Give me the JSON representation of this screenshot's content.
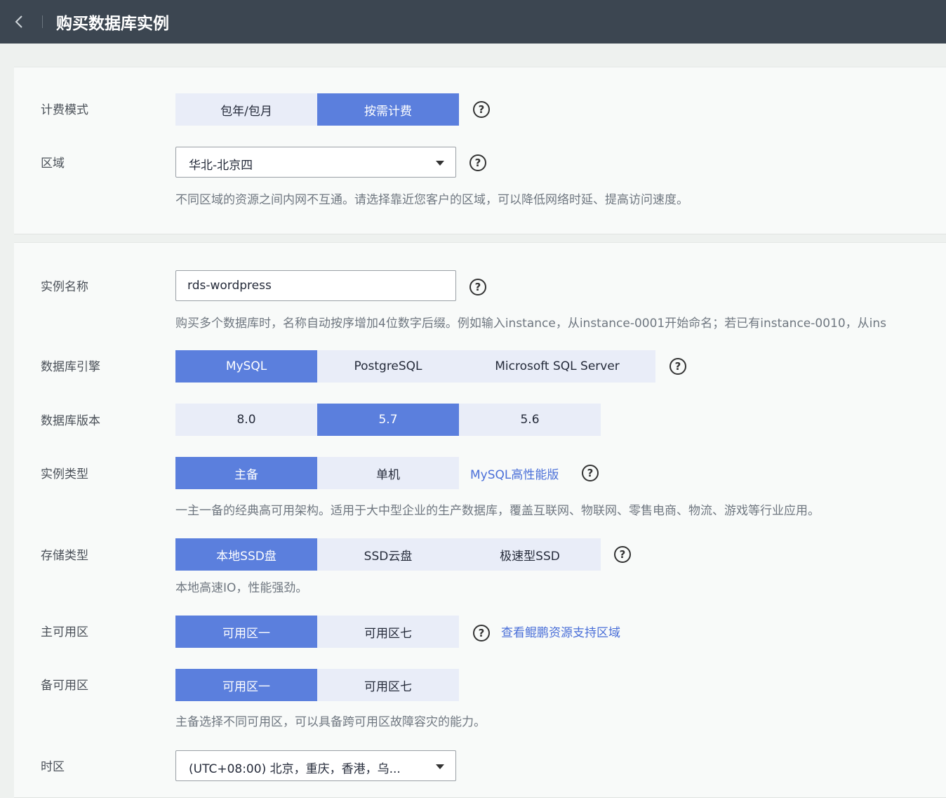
{
  "header": {
    "title": "购买数据库实例"
  },
  "billing": {
    "label": "计费模式",
    "options": [
      "包年/包月",
      "按需计费"
    ],
    "selected": "按需计费"
  },
  "region": {
    "label": "区域",
    "value": "华北-北京四",
    "hint": "不同区域的资源之间内网不互通。请选择靠近您客户的区域，可以降低网络时延、提高访问速度。"
  },
  "instance_name": {
    "label": "实例名称",
    "value": "rds-wordpress",
    "hint": "购买多个数据库时，名称自动按序增加4位数字后缀。例如输入instance，从instance-0001开始命名；若已有instance-0010，从ins"
  },
  "engine": {
    "label": "数据库引擎",
    "options": [
      "MySQL",
      "PostgreSQL",
      "Microsoft SQL Server"
    ],
    "selected": "MySQL"
  },
  "version": {
    "label": "数据库版本",
    "options": [
      "8.0",
      "5.7",
      "5.6"
    ],
    "selected": "5.7"
  },
  "instance_type": {
    "label": "实例类型",
    "options": [
      "主备",
      "单机"
    ],
    "selected": "主备",
    "link": "MySQL高性能版",
    "hint": "一主一备的经典高可用架构。适用于大中型企业的生产数据库，覆盖互联网、物联网、零售电商、物流、游戏等行业应用。"
  },
  "storage": {
    "label": "存储类型",
    "options": [
      "本地SSD盘",
      "SSD云盘",
      "极速型SSD"
    ],
    "selected": "本地SSD盘",
    "hint": "本地高速IO，性能强劲。"
  },
  "primary_az": {
    "label": "主可用区",
    "options": [
      "可用区一",
      "可用区七"
    ],
    "selected": "可用区一",
    "link": "查看鲲鹏资源支持区域"
  },
  "standby_az": {
    "label": "备可用区",
    "options": [
      "可用区一",
      "可用区七"
    ],
    "selected": "可用区一",
    "hint": "主备选择不同可用区，可以具备跨可用区故障容灾的能力。"
  },
  "timezone": {
    "label": "时区",
    "value": "(UTC+08:00) 北京，重庆，香港，乌..."
  },
  "colors": {
    "accent": "#5b7fdd",
    "topbar": "#3c4651",
    "link": "#4a6fd8"
  },
  "help_icon": "?"
}
